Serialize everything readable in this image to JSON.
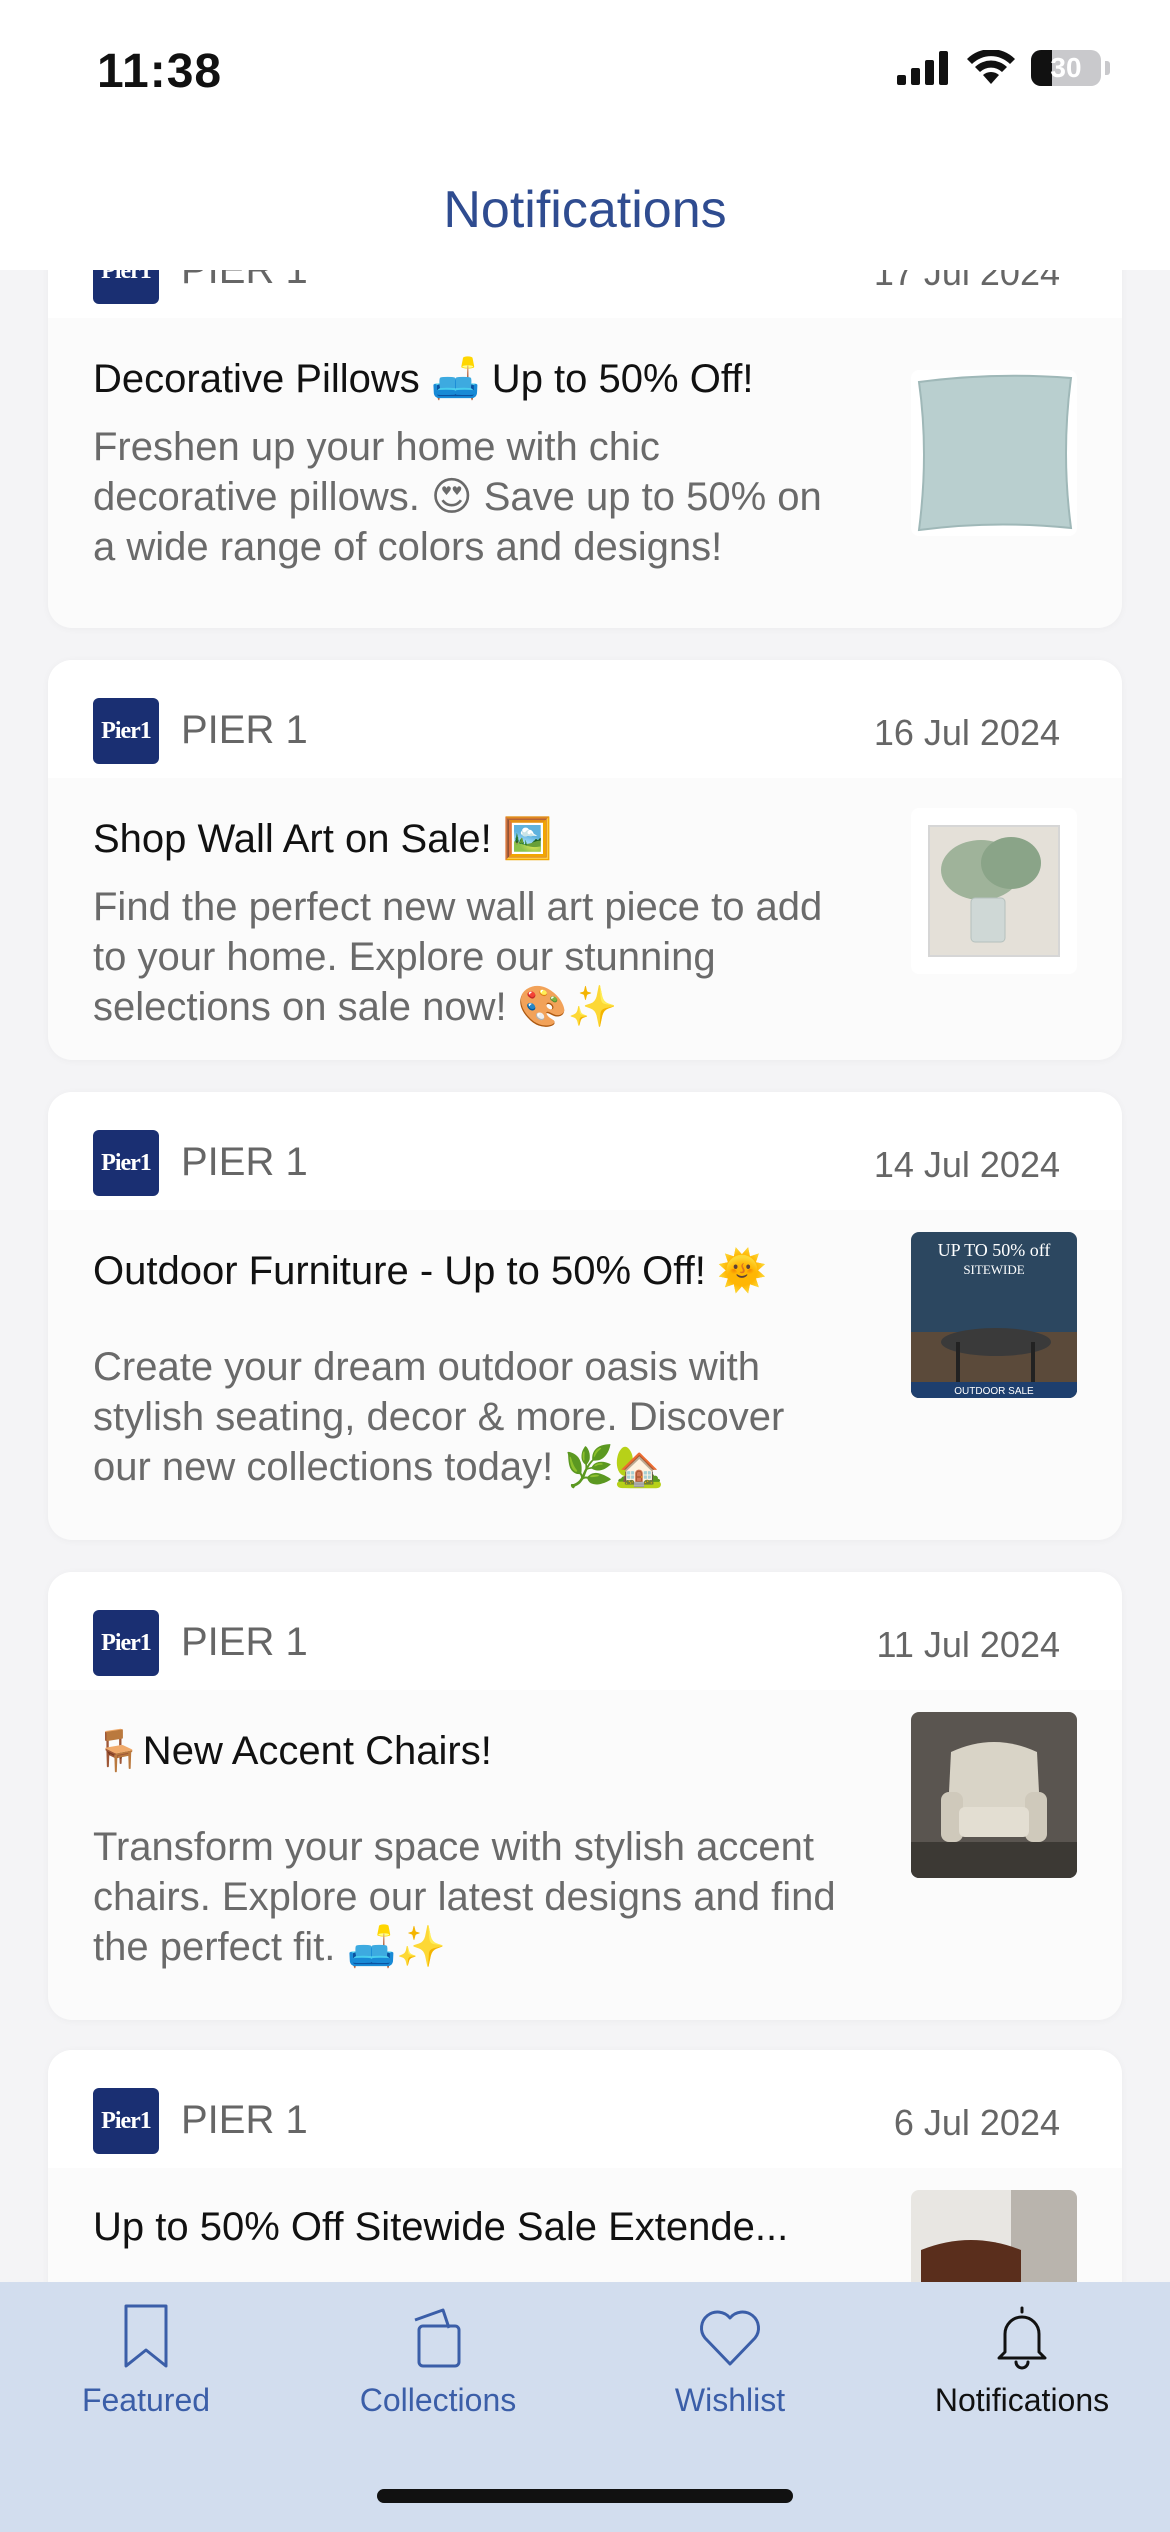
{
  "status_bar": {
    "time": "11:38",
    "battery": "30"
  },
  "header": {
    "title": "Notifications"
  },
  "notifications": [
    {
      "logo": "Pier1",
      "brand": "PIER 1",
      "date": "17 Jul 2024",
      "title": "Decorative Pillows 🛋️ Up to 50% Off!",
      "text": "Freshen up your home with chic decorative pillows. 😍 Save up to 50% on a wide range of colors and designs!",
      "image": "pillow-image"
    },
    {
      "logo": "Pier1",
      "brand": "PIER 1",
      "date": "16 Jul 2024",
      "title": "Shop Wall Art on Sale! 🖼️",
      "text": "Find the perfect new wall art piece to add to your home. Explore our stunning selections on sale now! 🎨✨",
      "image": "wall-art-image"
    },
    {
      "logo": "Pier1",
      "brand": "PIER 1",
      "date": "14 Jul 2024",
      "title": "Outdoor Furniture - Up to 50% Off! 🌞",
      "text": "Create your dream outdoor oasis with stylish seating, decor & more. Discover our new collections today! 🌿🏡",
      "image": "outdoor-furniture-image",
      "image_text": {
        "line1": "UP TO 50% off",
        "line2": "SITEWIDE",
        "footer": "OUTDOOR SALE"
      }
    },
    {
      "logo": "Pier1",
      "brand": "PIER 1",
      "date": "11 Jul 2024",
      "title": "🪑New Accent Chairs!",
      "text": "Transform your space with stylish accent chairs. Explore our latest designs and find the perfect fit. 🛋️✨",
      "image": "accent-chair-image"
    },
    {
      "logo": "Pier1",
      "brand": "PIER 1",
      "date": "6 Jul 2024",
      "title": "Up to 50% Off Sitewide Sale Extende...",
      "text": "",
      "image": "leather-chair-image"
    }
  ],
  "tabbar": {
    "tabs": [
      {
        "label": "Featured",
        "icon": "bookmark-icon",
        "active": false
      },
      {
        "label": "Collections",
        "icon": "collections-icon",
        "active": false
      },
      {
        "label": "Wishlist",
        "icon": "heart-icon",
        "active": false
      },
      {
        "label": "Notifications",
        "icon": "bell-icon",
        "active": true
      }
    ]
  },
  "colors": {
    "accent": "#2f4c90",
    "tab_inactive": "#3b5ea8",
    "tabbar_bg": "#d2ddee",
    "logo_bg": "#1a2f72"
  }
}
